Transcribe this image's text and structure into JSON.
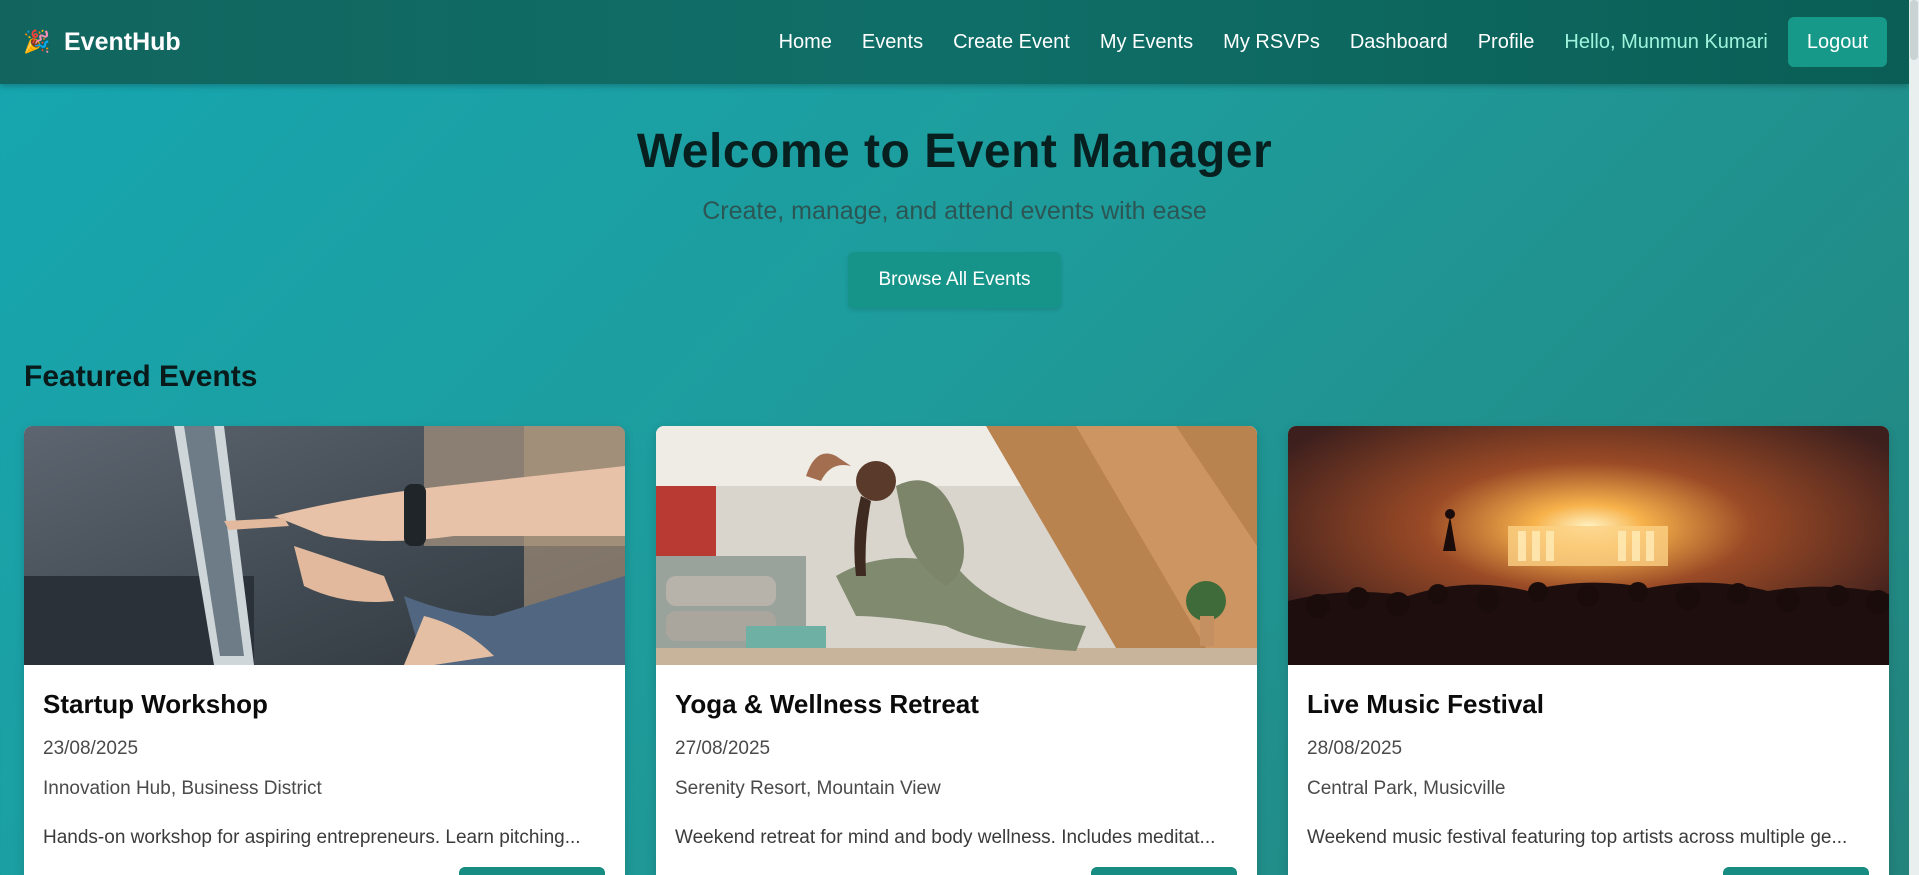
{
  "navbar": {
    "brand": "EventHub",
    "brand_icon": "party-popper-icon",
    "links": [
      "Home",
      "Events",
      "Create Event",
      "My Events",
      "My RSVPs",
      "Dashboard",
      "Profile"
    ],
    "greeting": "Hello, Munmun Kumari",
    "logout_label": "Logout"
  },
  "hero": {
    "title": "Welcome to Event Manager",
    "subtitle": "Create, manage, and attend events with ease",
    "button_label": "Browse All Events"
  },
  "featured": {
    "title": "Featured Events",
    "events": [
      {
        "title": "Startup Workshop",
        "date": "23/08/2025",
        "location": "Innovation Hub, Business District",
        "description": "Hands-on workshop for aspiring entrepreneurs. Learn pitching..."
      },
      {
        "title": "Yoga & Wellness Retreat",
        "date": "27/08/2025",
        "location": "Serenity Resort, Mountain View",
        "description": "Weekend retreat for mind and body wellness. Includes meditat..."
      },
      {
        "title": "Live Music Festival",
        "date": "28/08/2025",
        "location": "Central Park, Musicville",
        "description": "Weekend music festival featuring top artists across multiple ge..."
      }
    ]
  },
  "colors": {
    "nav_bg": "#0f6f68",
    "accent": "#17998a",
    "greeting": "#9ff3dc"
  }
}
